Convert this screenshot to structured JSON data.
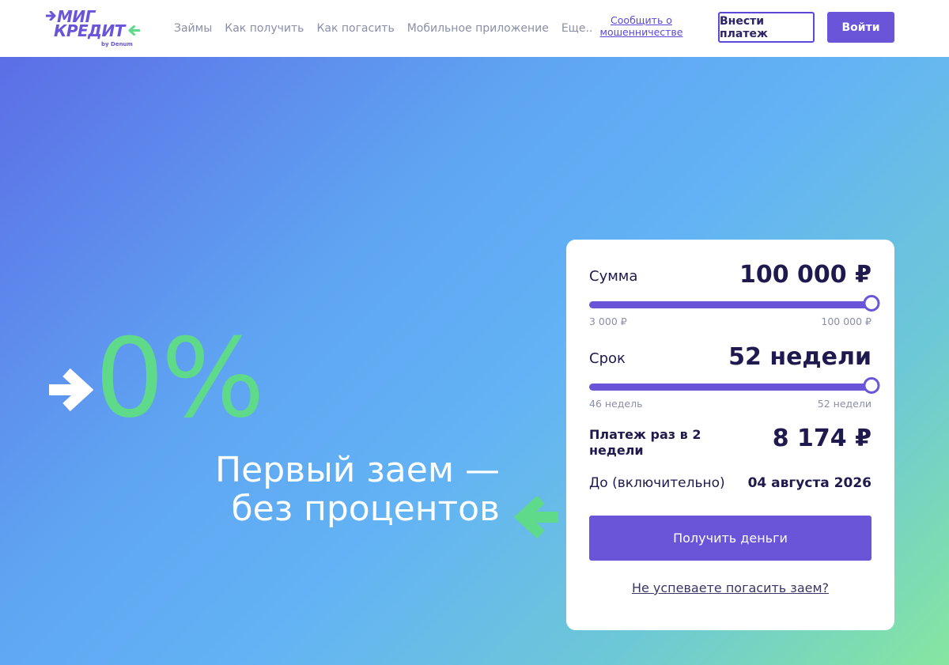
{
  "brand": {
    "name_line1": "МИГ",
    "name_line2": "КРЕДИТ",
    "sub": "by Denum",
    "color_primary": "#6a55d9",
    "color_accent": "#5fd98a",
    "logo_icon": "double-arrow-icon"
  },
  "nav": {
    "items": [
      "Займы",
      "Как получить",
      "Как погасить",
      "Мобильное приложение",
      "Еще.."
    ],
    "fraud_link": "Сообщить о мошенничестве",
    "pay_button": "Внести платеж",
    "login_button": "Войти"
  },
  "hero": {
    "percent": "0%",
    "title_line1": "Первый заем —",
    "title_line2": "без процентов",
    "arrow_right_icon": "arrow-right-icon",
    "arrow_left_icon": "arrow-left-icon"
  },
  "calculator": {
    "amount": {
      "label": "Сумма",
      "value": "100 000 ₽",
      "min": "3 000 ₽",
      "max": "100 000 ₽",
      "level": 1.0
    },
    "term": {
      "label": "Срок",
      "value": "52 недели",
      "min": "46 недель",
      "max": "52 недели",
      "level": 1.0
    },
    "payment": {
      "label": "Платеж раз в 2 недели",
      "value": "8 174 ₽"
    },
    "until": {
      "label": "До (включительно)",
      "value": "04 августа 2026"
    },
    "submit_button": "Получить деньги",
    "late_link": "Не успеваете погасить заем?"
  }
}
